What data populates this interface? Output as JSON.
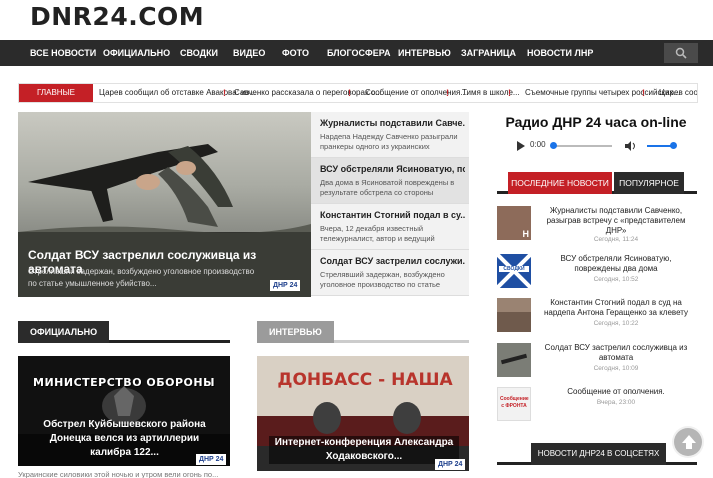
{
  "site": {
    "logo": "DNR24.COM"
  },
  "nav": {
    "items": [
      "ВСЕ НОВОСТИ",
      "ОФИЦИАЛЬНО",
      "СВОДКИ",
      "ВИДЕО",
      "ФОТО",
      "БЛОГОСФЕРА",
      "ИНТЕРВЬЮ",
      "ЗАГРАНИЦА",
      "НОВОСТИ ЛНР"
    ],
    "search_icon": "search-icon"
  },
  "ticker": {
    "label": "ГЛАВНЫЕ НОВОСТИ",
    "items": [
      "Царев сообщил об отставке Авакова: из...",
      "Савченко рассказала о переговорах с...",
      "Сообщение от ополчения...",
      "Тимя в школе...",
      "Съемочные группы четырех российских...",
      "Царев сооб"
    ],
    "marker": "!"
  },
  "hero": {
    "title": "Солдат ВСУ застрелил сослуживца из автомата",
    "desc": "Стрелявший задержан, возбуждено уголовное производство по статье умышленное убийство...",
    "badge": "ДНР 24"
  },
  "side_list": [
    {
      "title": "Журналисты подставили Савче...",
      "desc": "Нардепа Надежду Савченко разыграли пранкеры одного из украинских"
    },
    {
      "title": "ВСУ обстреляли Ясиноватую, по...",
      "desc": "Два дома в Ясиноватой повреждены в результате обстрела со стороны"
    },
    {
      "title": "Константин Стогний подал в су...",
      "desc": "Вчера, 12 декабря известный тележурналист, автор и ведущий"
    },
    {
      "title": "Солдат ВСУ застрелил сослужи...",
      "desc": "Стрелявший задержан, возбуждено уголовное производство по статье"
    }
  ],
  "sections": {
    "official": {
      "label": "ОФИЦИАЛЬНО",
      "banner": "МИНИСТЕРСТВО ОБОРОНЫ",
      "caption": "Обстрел Куйбышевского района Донецка велся из артиллерии калибра 122...",
      "badge": "ДНР 24"
    },
    "interview": {
      "label": "ИНТЕРВЬЮ",
      "banner": "ДОНБАСС - НАША",
      "caption": "Интернет-конференция Александра Ходаковского...",
      "badge": "ДНР 24"
    }
  },
  "radio": {
    "title": "Радио ДНР 24 часа on-line",
    "time": "0:00"
  },
  "tabs": {
    "recent": "ПОСЛЕДНИЕ НОВОСТИ",
    "popular": "ПОПУЛЯРНОЕ"
  },
  "recent": [
    {
      "title": "Журналисты подставили Савченко, разыграв встречу с «представителем ДНР»",
      "date": "Сегодня, 11:24",
      "thumb": "Н"
    },
    {
      "title": "ВСУ обстреляли Ясиноватую, повреждены два дома",
      "date": "Сегодня, 10:52",
      "thumb": "СВОДКИ"
    },
    {
      "title": "Константин Стогний подал в суд на нардепа Антона Геращенко за клевету",
      "date": "Сегодня, 10:22",
      "thumb": ""
    },
    {
      "title": "Солдат ВСУ застрелил сослуживца из автомата",
      "date": "Сегодня, 10:09",
      "thumb": ""
    },
    {
      "title": "Сообщение от ополчения.",
      "date": "Вчера, 23:00",
      "thumb": "Сообщение с ФРОНТА"
    }
  ],
  "social": {
    "label": "НОВОСТИ ДНР24 В СОЦСЕТЯХ"
  },
  "bottom_text": "Украинские силовики этой ночью и утром вели огонь по...",
  "colors": {
    "accent_red": "#c42026",
    "dark": "#2b2b2b",
    "link_blue": "#1a73e8"
  }
}
